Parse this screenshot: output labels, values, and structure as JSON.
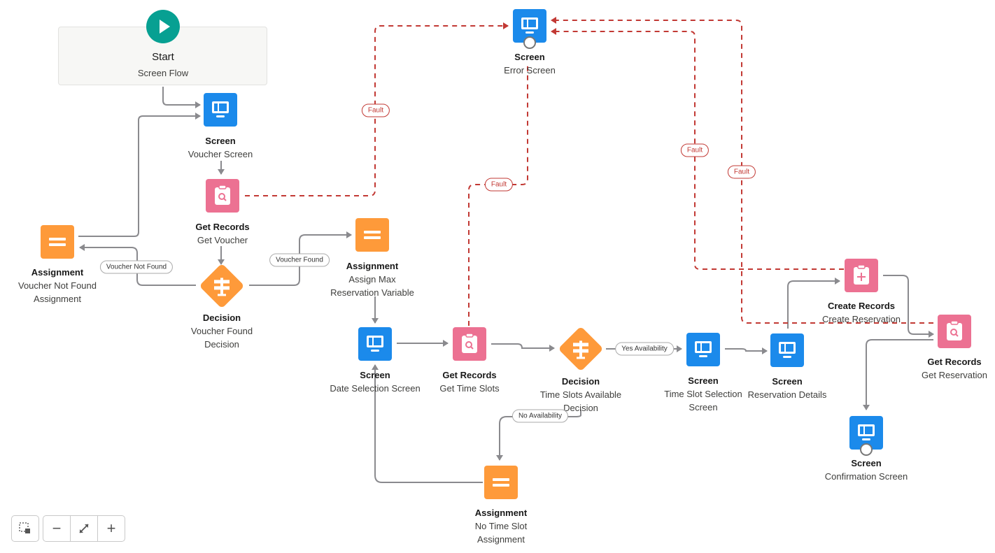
{
  "start": {
    "title": "Start",
    "subtitle": "Screen Flow",
    "icon": "play-icon"
  },
  "nodes": {
    "voucher_screen": {
      "type": "Screen",
      "name": "Voucher Screen"
    },
    "get_voucher": {
      "type": "Get Records",
      "name": "Get Voucher"
    },
    "voucher_not_found_assign": {
      "type": "Assignment",
      "name1": "Voucher Not Found",
      "name2": "Assignment"
    },
    "voucher_found_decision": {
      "type": "Decision",
      "name1": "Voucher Found",
      "name2": "Decision"
    },
    "assign_max": {
      "type": "Assignment",
      "name1": "Assign Max",
      "name2": "Reservation Variable"
    },
    "error_screen": {
      "type": "Screen",
      "name": "Error Screen"
    },
    "date_selection": {
      "type": "Screen",
      "name": "Date Selection Screen"
    },
    "get_time_slots": {
      "type": "Get Records",
      "name": "Get Time Slots"
    },
    "time_slots_decision": {
      "type": "Decision",
      "name1": "Time Slots Available",
      "name2": "Decision"
    },
    "no_time_slot_assign": {
      "type": "Assignment",
      "name1": "No Time Slot",
      "name2": "Assignment"
    },
    "time_slot_selection": {
      "type": "Screen",
      "name1": "Time Slot Selection",
      "name2": "Screen"
    },
    "reservation_details": {
      "type": "Screen",
      "name": "Reservation Details"
    },
    "create_reservation": {
      "type": "Create Records",
      "name": "Create Reservation"
    },
    "get_reservation": {
      "type": "Get Records",
      "name": "Get Reservation"
    },
    "confirmation_screen": {
      "type": "Screen",
      "name": "Confirmation Screen"
    }
  },
  "connector_labels": {
    "voucher_not_found": "Voucher Not Found",
    "voucher_found": "Voucher Found",
    "yes_availability": "Yes Availability",
    "no_availability": "No Availability",
    "fault": "Fault"
  },
  "colors": {
    "screen": "#1b8aeb",
    "records": "#ec7192",
    "logic": "#fe9a3a",
    "start": "#07a092",
    "fault": "#c23934",
    "connector": "#8a8a8e"
  },
  "zoom_controls": {
    "select": "select-mode-icon",
    "zoom_out": "−",
    "fit": "fit-view-icon",
    "zoom_in": "+"
  }
}
